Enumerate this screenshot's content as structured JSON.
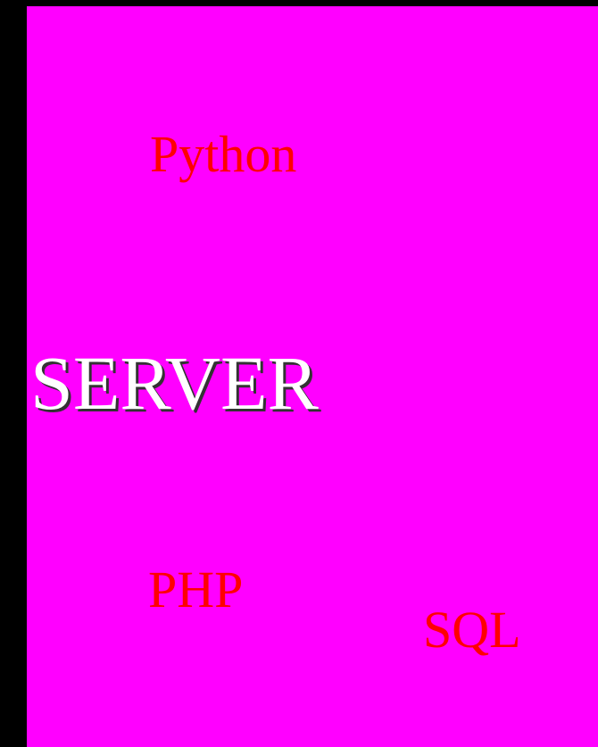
{
  "colors": {
    "frame_background": "#000000",
    "panel_background": "#ff00ff",
    "small_word_color": "#ff0000",
    "main_word_color": "#ffffff",
    "main_word_shadow": "#333333"
  },
  "words": {
    "python": "Python",
    "server": "SERVER",
    "php": "PHP",
    "sql": "SQL"
  }
}
